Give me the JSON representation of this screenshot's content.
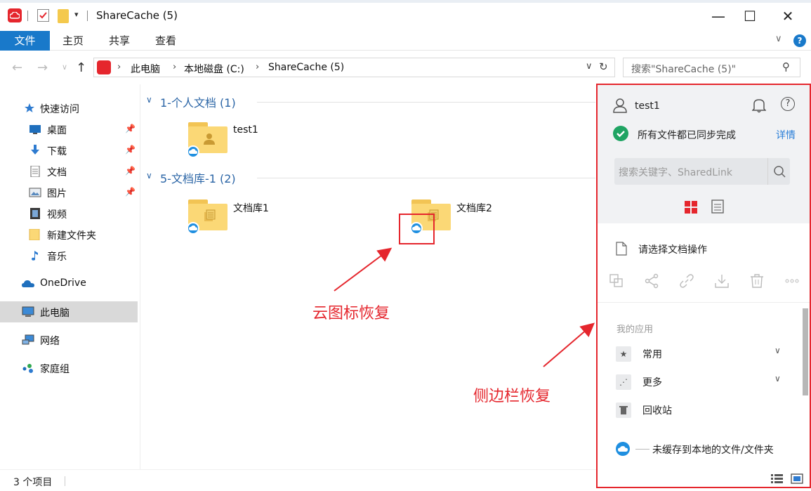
{
  "window": {
    "title": "ShareCache (5)",
    "min_glyph": "—",
    "max_glyph": "☐",
    "close_glyph": "✕",
    "quick_access_dropdown": "▾"
  },
  "ribbon": {
    "tabs": [
      {
        "label": "文件"
      },
      {
        "label": "主页"
      },
      {
        "label": "共享"
      },
      {
        "label": "查看"
      }
    ],
    "help_glyph": "?",
    "expand_glyph": "∨"
  },
  "address": {
    "crumbs": [
      "此电脑",
      "本地磁盘 (C:)",
      "ShareCache (5)"
    ],
    "search_placeholder": "搜索\"ShareCache (5)\""
  },
  "nav_pane": {
    "items": [
      {
        "label": "快速访问",
        "icon": "star-icon",
        "pinned": false
      },
      {
        "label": "桌面",
        "icon": "desktop-icon",
        "pinned": true
      },
      {
        "label": "下载",
        "icon": "download-arrow-icon",
        "pinned": true
      },
      {
        "label": "文档",
        "icon": "document-icon",
        "pinned": true
      },
      {
        "label": "图片",
        "icon": "picture-icon",
        "pinned": true
      },
      {
        "label": "视频",
        "icon": "video-icon",
        "pinned": false
      },
      {
        "label": "新建文件夹",
        "icon": "folder-icon",
        "pinned": false
      },
      {
        "label": "音乐",
        "icon": "music-note-icon",
        "pinned": false
      },
      {
        "label": "OneDrive",
        "icon": "onedrive-cloud-icon",
        "pinned": false
      },
      {
        "label": "此电脑",
        "icon": "computer-icon",
        "pinned": false,
        "selected": true
      },
      {
        "label": "网络",
        "icon": "network-icon",
        "pinned": false
      },
      {
        "label": "家庭组",
        "icon": "homegroup-icon",
        "pinned": false
      }
    ]
  },
  "content": {
    "groups": [
      {
        "title": "1-个人文档 (1)",
        "items": [
          {
            "name": "test1",
            "type": "personal-folder"
          }
        ]
      },
      {
        "title": "5-文档库-1 (2)",
        "items": [
          {
            "name": "文档库1",
            "type": "library-folder"
          },
          {
            "name": "文档库2",
            "type": "library-folder"
          }
        ]
      }
    ]
  },
  "annotations": {
    "cloud_icon_restored": "云图标恢复",
    "sidebar_restored": "侧边栏恢复"
  },
  "sidebar": {
    "user": "test1",
    "help_glyph": "?",
    "sync_status": "所有文件都已同步完成",
    "details_link": "详情",
    "search_placeholder": "搜索关键字、SharedLink",
    "doc_op_prompt": "请选择文档操作",
    "apps_header": "我的应用",
    "apps": [
      {
        "label": "常用",
        "icon": "star-icon",
        "glyph": "★",
        "expandable": true
      },
      {
        "label": "更多",
        "icon": "more-apps-icon",
        "glyph": "⋰",
        "expandable": true
      },
      {
        "label": "回收站",
        "icon": "trash-icon",
        "glyph": "🗑",
        "expandable": false
      }
    ],
    "footer": "未缓存到本地的文件/文件夹"
  },
  "status": {
    "item_count": "3 个项目"
  },
  "colors": {
    "accent_blue": "#1979ca",
    "link_blue": "#2a7fd8",
    "annotation_red": "#e5262d",
    "sync_green": "#1fa463",
    "cloud_blue": "#1f8fe0"
  }
}
